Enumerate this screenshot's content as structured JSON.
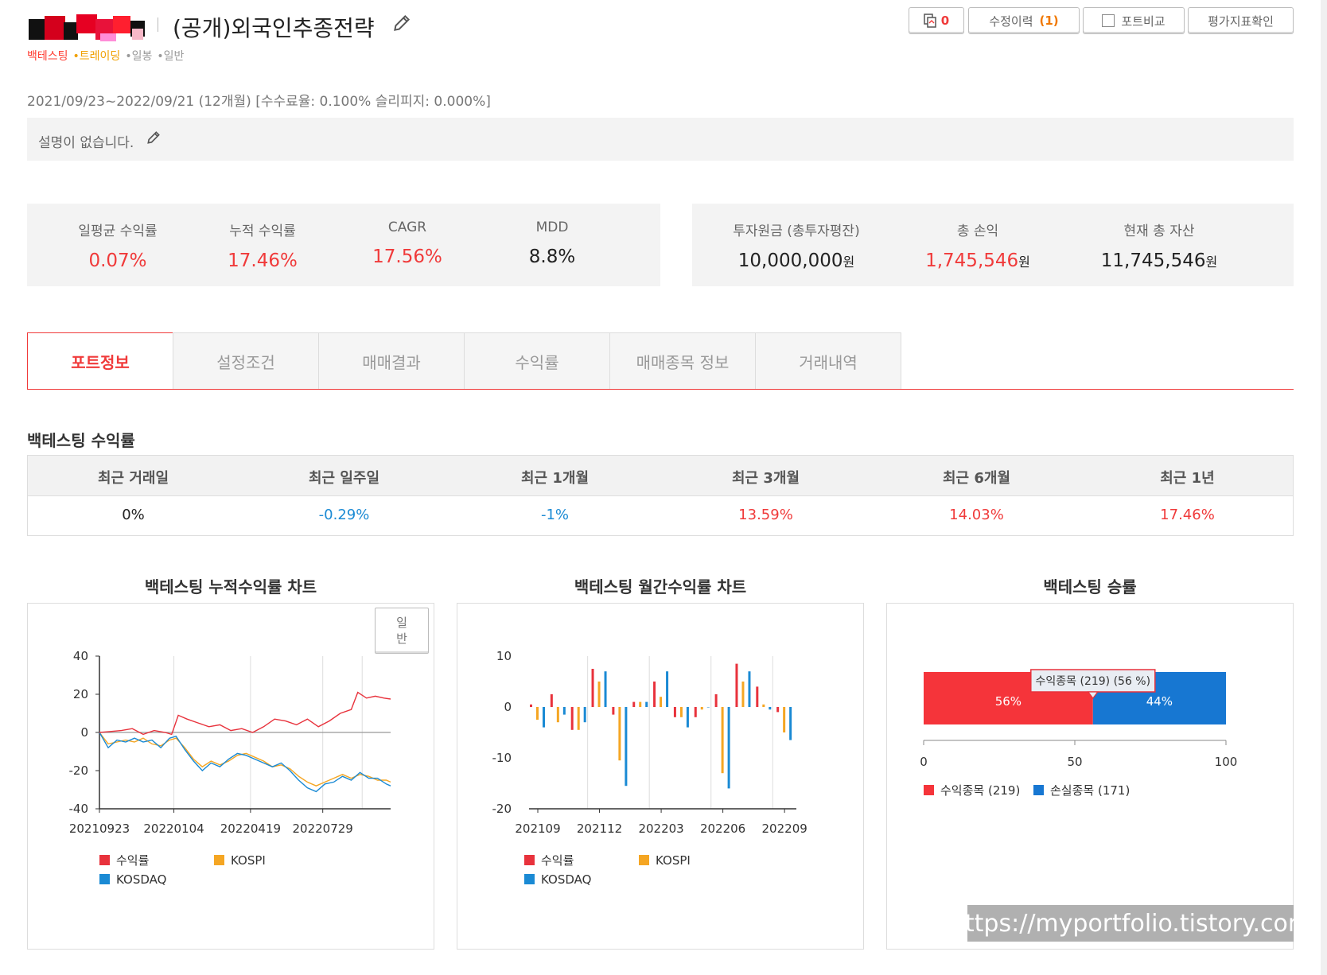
{
  "header": {
    "title": "(공개)외국인추종전략",
    "tags": [
      {
        "label": "백테스팅",
        "color": "#ff3b30"
      },
      {
        "label": "•트레이딩",
        "color": "#f0a000"
      },
      {
        "label": "•일봉",
        "color": "#999999"
      },
      {
        "label": "•일반",
        "color": "#999999"
      }
    ],
    "copy_count": "0",
    "history_label": "수정이력",
    "history_count": "(1)",
    "compare_label": "포트비교",
    "eval_label": "평가지표확인"
  },
  "period": "2021/09/23~2022/09/21 (12개월) [수수료율: 0.100% 슬리피지: 0.000%]",
  "description": "설명이 없습니다.",
  "stats_left": [
    {
      "label": "일평균 수익률",
      "value": "0.07%",
      "color": "red"
    },
    {
      "label": "누적 수익률",
      "value": "17.46%",
      "color": "red"
    },
    {
      "label": "CAGR",
      "value": "17.56%",
      "color": "red"
    },
    {
      "label": "MDD",
      "value": "8.8%",
      "color": "dark"
    }
  ],
  "stats_right": [
    {
      "label": "투자원금 (총투자평잔)",
      "value": "10,000,000",
      "unit": "원",
      "color": "dark"
    },
    {
      "label": "총 손익",
      "value": "1,745,546",
      "unit": "원",
      "color": "red"
    },
    {
      "label": "현재 총 자산",
      "value": "11,745,546",
      "unit": "원",
      "color": "dark"
    }
  ],
  "tabs": [
    "포트정보",
    "설정조건",
    "매매결과",
    "수익률",
    "매매종목 정보",
    "거래내역"
  ],
  "returns": {
    "title": "백테스팅 수익률",
    "headers": [
      "최근 거래일",
      "최근 일주일",
      "최근 1개월",
      "최근 3개월",
      "최근 6개월",
      "최근 1년"
    ],
    "values": [
      {
        "v": "0%",
        "color": "dark"
      },
      {
        "v": "-0.29%",
        "color": "blue"
      },
      {
        "v": "-1%",
        "color": "blue"
      },
      {
        "v": "13.59%",
        "color": "red"
      },
      {
        "v": "14.03%",
        "color": "red"
      },
      {
        "v": "17.46%",
        "color": "red"
      }
    ]
  },
  "toggle_label": "일반",
  "watermark": "https://myportfolio.tistory.com",
  "chart_data": [
    {
      "type": "line",
      "title": "백테스팅 누적수익률 차트",
      "ylim": [
        -40,
        40
      ],
      "yticks": [
        40,
        20,
        0,
        -20,
        -40
      ],
      "xticks": [
        "20210923",
        "20220104",
        "20220419",
        "20220729"
      ],
      "x_months": [
        0,
        3.4,
        6.9,
        10.2,
        12
      ],
      "series": [
        {
          "name": "수익률",
          "color": "#e8323c",
          "points": [
            [
              0,
              0
            ],
            [
              0.5,
              0.5
            ],
            [
              1,
              1
            ],
            [
              1.5,
              2
            ],
            [
              2,
              -1
            ],
            [
              2.5,
              1
            ],
            [
              3,
              0
            ],
            [
              3.3,
              -1
            ],
            [
              3.6,
              9
            ],
            [
              4,
              7
            ],
            [
              4.5,
              5
            ],
            [
              5,
              3
            ],
            [
              5.5,
              4
            ],
            [
              6,
              1
            ],
            [
              6.5,
              2
            ],
            [
              7,
              0
            ],
            [
              7.5,
              3
            ],
            [
              8,
              7
            ],
            [
              8.5,
              6
            ],
            [
              9,
              4
            ],
            [
              9.5,
              7
            ],
            [
              10,
              3
            ],
            [
              10.5,
              6
            ],
            [
              11,
              10
            ],
            [
              11.5,
              12
            ],
            [
              11.8,
              21
            ],
            [
              12.2,
              18
            ],
            [
              12.6,
              19
            ],
            [
              13,
              18
            ],
            [
              13.3,
              17.5
            ]
          ]
        },
        {
          "name": "KOSPI",
          "color": "#f5a623",
          "points": [
            [
              0,
              0
            ],
            [
              0.4,
              -6
            ],
            [
              0.8,
              -5
            ],
            [
              1.2,
              -4
            ],
            [
              1.6,
              -5
            ],
            [
              2,
              -3
            ],
            [
              2.4,
              -6
            ],
            [
              2.8,
              -7
            ],
            [
              3.2,
              -4
            ],
            [
              3.5,
              -3
            ],
            [
              3.9,
              -8
            ],
            [
              4.3,
              -14
            ],
            [
              4.7,
              -18
            ],
            [
              5.1,
              -15
            ],
            [
              5.5,
              -17
            ],
            [
              5.9,
              -15
            ],
            [
              6.3,
              -12
            ],
            [
              6.7,
              -11
            ],
            [
              7.1,
              -13
            ],
            [
              7.5,
              -15
            ],
            [
              7.9,
              -18
            ],
            [
              8.3,
              -17
            ],
            [
              8.7,
              -19
            ],
            [
              9.1,
              -23
            ],
            [
              9.5,
              -26
            ],
            [
              9.9,
              -28
            ],
            [
              10.3,
              -26
            ],
            [
              10.7,
              -24
            ],
            [
              11.1,
              -22
            ],
            [
              11.5,
              -24
            ],
            [
              11.9,
              -22
            ],
            [
              12.3,
              -23
            ],
            [
              12.7,
              -25
            ],
            [
              13.1,
              -25
            ],
            [
              13.3,
              -26
            ]
          ]
        },
        {
          "name": "KOSDAQ",
          "color": "#1a8ad4",
          "points": [
            [
              0,
              0
            ],
            [
              0.4,
              -8
            ],
            [
              0.8,
              -4
            ],
            [
              1.2,
              -5
            ],
            [
              1.6,
              -3
            ],
            [
              2,
              -5
            ],
            [
              2.4,
              -4
            ],
            [
              2.8,
              -8
            ],
            [
              3.2,
              -3
            ],
            [
              3.5,
              -2
            ],
            [
              3.9,
              -9
            ],
            [
              4.3,
              -15
            ],
            [
              4.7,
              -20
            ],
            [
              5.1,
              -16
            ],
            [
              5.5,
              -18
            ],
            [
              5.9,
              -14
            ],
            [
              6.3,
              -11
            ],
            [
              6.7,
              -12
            ],
            [
              7.1,
              -14
            ],
            [
              7.5,
              -16
            ],
            [
              7.9,
              -18
            ],
            [
              8.3,
              -16
            ],
            [
              8.7,
              -20
            ],
            [
              9.1,
              -25
            ],
            [
              9.5,
              -29
            ],
            [
              9.9,
              -31
            ],
            [
              10.3,
              -27
            ],
            [
              10.7,
              -26
            ],
            [
              11.1,
              -23
            ],
            [
              11.5,
              -25
            ],
            [
              11.9,
              -21
            ],
            [
              12.3,
              -24
            ],
            [
              12.7,
              -24
            ],
            [
              13.1,
              -27
            ],
            [
              13.3,
              -28
            ]
          ]
        }
      ]
    },
    {
      "type": "bar",
      "title": "백테스팅 월간수익률 차트",
      "ylim": [
        -20,
        10
      ],
      "yticks": [
        10,
        0,
        -10,
        -20
      ],
      "xticks": [
        "202109",
        "202112",
        "202203",
        "202206",
        "202209"
      ],
      "categories": [
        "202109",
        "202110",
        "202111",
        "202112",
        "202201",
        "202202",
        "202203",
        "202204",
        "202205",
        "202206",
        "202207",
        "202208",
        "202209"
      ],
      "series": [
        {
          "name": "수익률",
          "color": "#e8323c",
          "values": [
            0.5,
            2.5,
            -4.5,
            7.5,
            -1.5,
            1.0,
            5.0,
            -2.0,
            -2.0,
            2.5,
            8.5,
            4.0,
            -1.0
          ]
        },
        {
          "name": "KOSPI",
          "color": "#f5a623",
          "values": [
            -2.5,
            -3.0,
            -4.5,
            5.0,
            -10.5,
            1.0,
            2.0,
            -2.0,
            -0.5,
            -13.0,
            5.0,
            0.5,
            -5.0
          ]
        },
        {
          "name": "KOSDAQ",
          "color": "#1a8ad4",
          "values": [
            -4.0,
            -1.5,
            -3.0,
            7.0,
            -15.5,
            1.0,
            7.0,
            -4.0,
            0.0,
            -16.0,
            7.0,
            -0.5,
            -6.5
          ]
        }
      ]
    },
    {
      "type": "bar",
      "title": "백테스팅 승률",
      "xlim": [
        0,
        100
      ],
      "xticks": [
        0,
        50,
        100
      ],
      "series": [
        {
          "name": "수익종목 (219)",
          "value": 56,
          "label": "56%",
          "color": "#f5343a"
        },
        {
          "name": "손실종목 (171)",
          "value": 44,
          "label": "44%",
          "color": "#1777d2"
        }
      ],
      "tooltip": "수익종목 (219) (56 %)"
    }
  ]
}
